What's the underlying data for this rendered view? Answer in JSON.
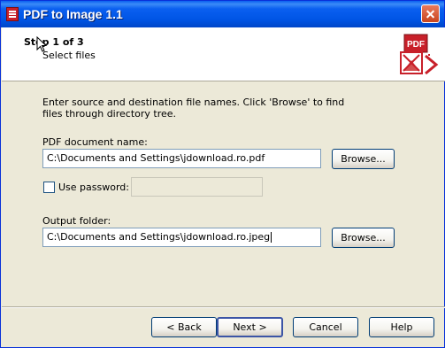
{
  "window": {
    "title": "PDF to Image 1.1"
  },
  "header": {
    "step_title": "Step 1 of 3",
    "step_subtitle": "Select files"
  },
  "instructions": "Enter source and destination file names. Click 'Browse' to find files through directory tree.",
  "pdf": {
    "label": "PDF document name:",
    "value": "C:\\Documents and Settings\\jdownload.ro.pdf",
    "browse_label": "Browse..."
  },
  "password": {
    "label": "Use password:",
    "checked": false,
    "value": ""
  },
  "output": {
    "label": "Output folder:",
    "value": "C:\\Documents and Settings\\jdownload.ro.jpeg",
    "browse_label": "Browse..."
  },
  "footer": {
    "back_label": "< Back",
    "next_label": "Next >",
    "cancel_label": "Cancel",
    "help_label": "Help"
  },
  "colors": {
    "titlebar": "#0055e5",
    "dialog_bg": "#ece9d8",
    "header_bg": "#ffffff",
    "pdf_icon_red": "#c8202a"
  },
  "icons": [
    "pdf-icon",
    "close-icon",
    "cursor-icon",
    "pdf-to-image-logo-icon"
  ]
}
